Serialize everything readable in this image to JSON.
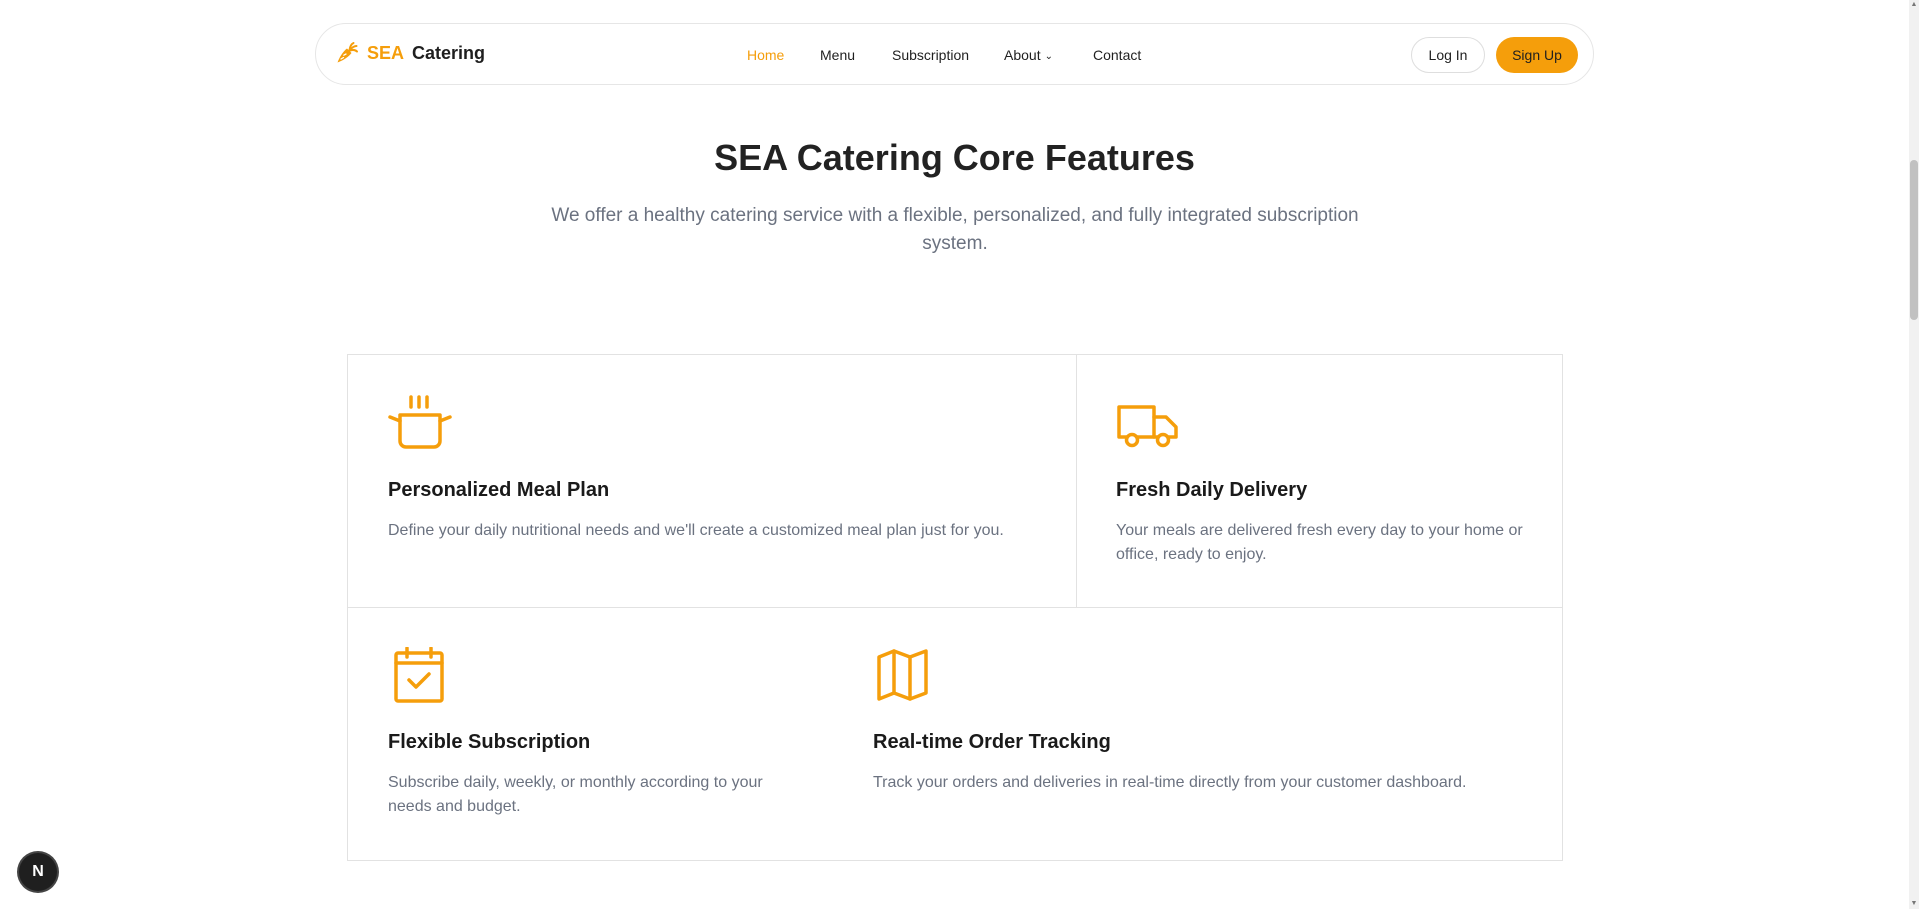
{
  "brand": {
    "highlight": "SEA",
    "name": "Catering",
    "accent_color": "#f59e0b"
  },
  "nav": {
    "items": [
      {
        "label": "Home",
        "active": true
      },
      {
        "label": "Menu",
        "active": false
      },
      {
        "label": "Subscription",
        "active": false
      },
      {
        "label": "About",
        "active": false,
        "dropdown": true
      },
      {
        "label": "Contact",
        "active": false
      }
    ],
    "login_label": "Log In",
    "signup_label": "Sign Up"
  },
  "hero": {
    "title": "SEA Catering Core Features",
    "subtitle": "We offer a healthy catering service with a flexible, personalized, and fully integrated subscription system."
  },
  "features": [
    {
      "icon": "cooking-pot-icon",
      "title": "Personalized Meal Plan",
      "description": "Define your daily nutritional needs and we'll create a customized meal plan just for you."
    },
    {
      "icon": "delivery-truck-icon",
      "title": "Fresh Daily Delivery",
      "description": "Your meals are delivered fresh every day to your home or office, ready to enjoy."
    },
    {
      "icon": "calendar-check-icon",
      "title": "Flexible Subscription",
      "description": "Subscribe daily, weekly, or monthly according to your needs and budget."
    },
    {
      "icon": "map-icon",
      "title": "Real-time Order Tracking",
      "description": "Track your orders and deliveries in real-time directly from your customer dashboard."
    }
  ],
  "badge": {
    "letter": "N"
  },
  "icons": {
    "logo": "carrot-icon",
    "about_dropdown": "chevron-down-icon",
    "scroll_up": "scroll-up-arrow-icon",
    "scroll_down": "scroll-down-arrow-icon"
  }
}
